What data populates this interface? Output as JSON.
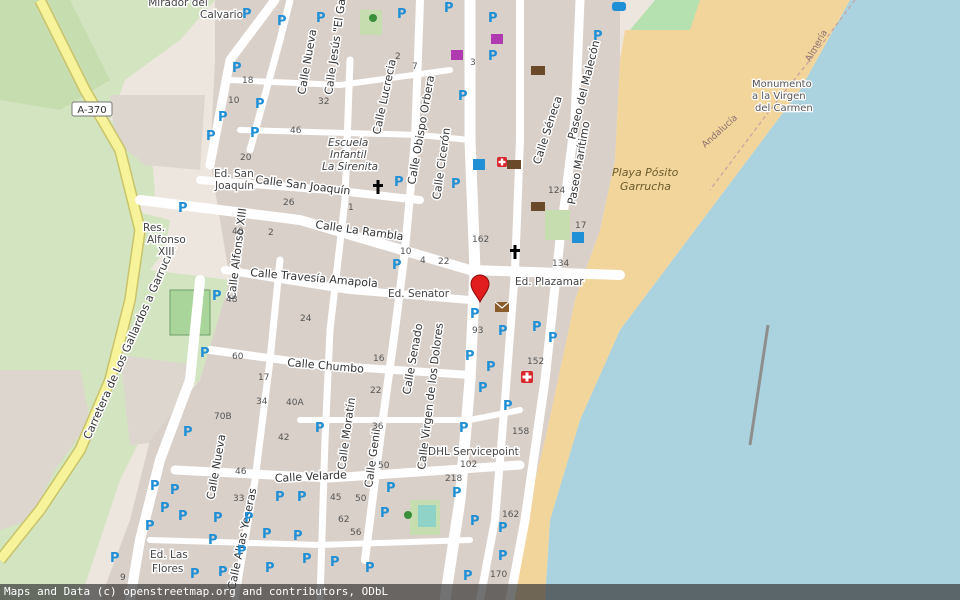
{
  "attribution": "Maps and Data (c) openstreetmap.org and contributors, ODbL",
  "road_shield": "A-370",
  "streets": [
    "Calle Nueva",
    "Calle Jesús \"El Gallo\"",
    "Calle Lucrecia",
    "Calle Obispo Orbera",
    "Calle Cicerón",
    "Calle Séneca",
    "Paseo del Malecón",
    "Paseo Marítimo",
    "Calle San Joaquín",
    "Calle La Rambla",
    "Calle Alfonso XIII",
    "Calle Travesía Amapola",
    "Calle Chumbo",
    "Calle Senado",
    "Calle Virgen de los Dolores",
    "Calle Moratín",
    "Calle Genil",
    "Calle Velarde",
    "Calle Nueva",
    "Calle Altas Yeseras",
    "Carretera de Los Gallardos a Garrucha"
  ],
  "places": [
    "Mirador del Calvario",
    "Escuela Infantil La Sirenita",
    "Ed. San Joaquín",
    "Res. Alfonso XIII",
    "Ed. Senator",
    "Ed. Plazamar",
    "DHL Servicepoint",
    "Ed. Las Flores",
    "Playa Pósito Garrucha",
    "Monumento a la Virgen del Carmen",
    "Andalucía",
    "Almería"
  ],
  "colors": {
    "background": "#ede6de",
    "sea": "#aad3df",
    "beach": "#f4c97a",
    "green": "#c6ddb0",
    "road": "#ffffff",
    "motorway": "#f6f39a",
    "parking": "#1f8fd6",
    "marker": "#e11d1d"
  },
  "icons": [
    "parking-icon",
    "church-icon",
    "post-office-icon",
    "pharmacy-icon",
    "location-pin-icon",
    "playground-icon"
  ]
}
